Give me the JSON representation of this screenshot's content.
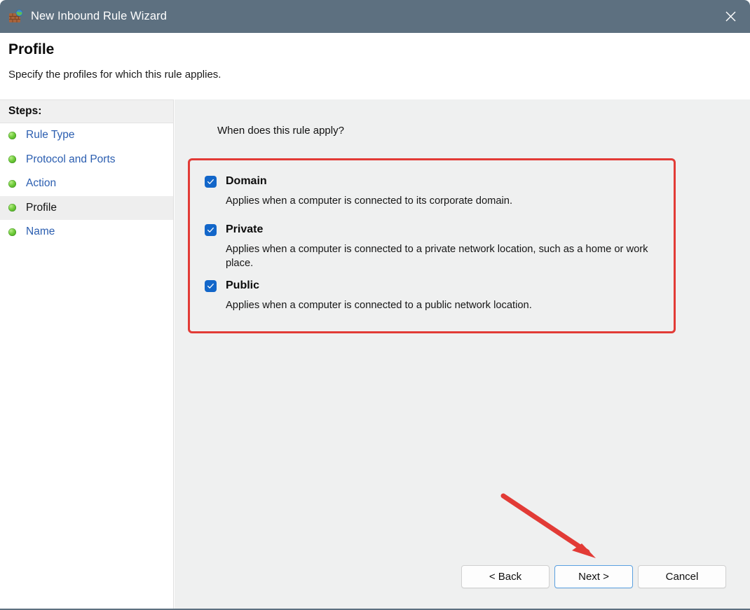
{
  "window": {
    "title": "New Inbound Rule Wizard",
    "icon": "firewall-brick-globe-icon",
    "close_label": "✕",
    "titlebar_color": "#5d7080"
  },
  "header": {
    "title": "Profile",
    "subtitle": "Specify the profiles for which this rule applies."
  },
  "sidebar": {
    "header": "Steps:",
    "items": [
      {
        "label": "Rule Type",
        "current": false
      },
      {
        "label": "Protocol and Ports",
        "current": false
      },
      {
        "label": "Action",
        "current": false
      },
      {
        "label": "Profile",
        "current": true
      },
      {
        "label": "Name",
        "current": false
      }
    ]
  },
  "main": {
    "question": "When does this rule apply?",
    "profiles": [
      {
        "name": "Domain",
        "description": "Applies when a computer is connected to its corporate domain.",
        "checked": true
      },
      {
        "name": "Private",
        "description": "Applies when a computer is connected to a private network location, such as a home or work place.",
        "checked": true
      },
      {
        "name": "Public",
        "description": "Applies when a computer is connected to a public network location.",
        "checked": true
      }
    ]
  },
  "footer": {
    "back_label": "< Back",
    "next_label": "Next >",
    "cancel_label": "Cancel"
  },
  "annotations": {
    "highlight_color": "#e23b36",
    "arrow_color": "#e23b36",
    "checkbox_color": "#1266c9",
    "link_color": "#2b5eb0"
  }
}
